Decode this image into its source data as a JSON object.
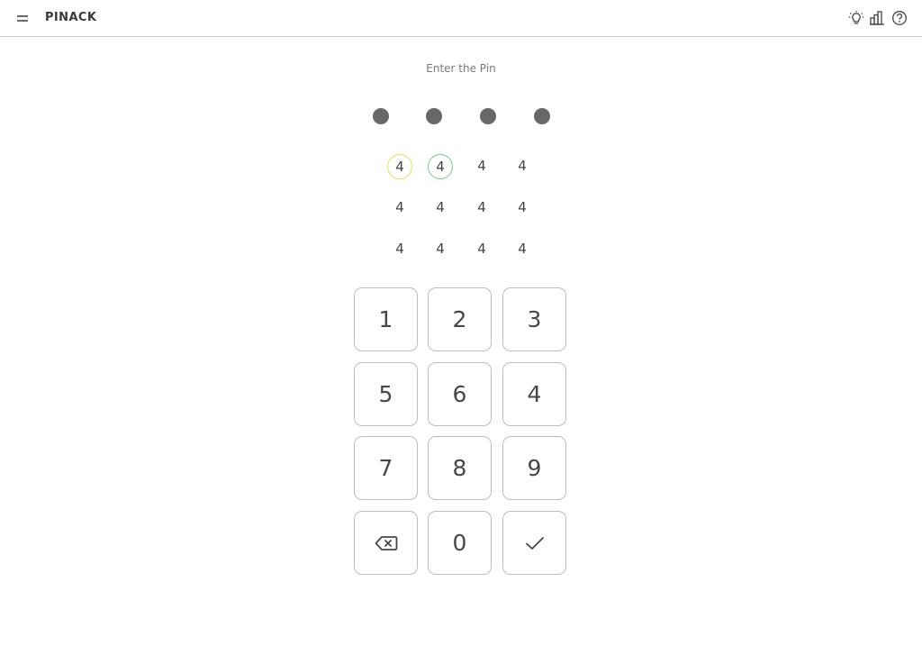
{
  "header": {
    "title": "PINACK",
    "icons": [
      "menu-icon",
      "lightbulb-icon",
      "bar-chart-icon",
      "help-icon"
    ]
  },
  "prompt": "Enter the Pin",
  "pin_dots": 4,
  "digit_grid": [
    [
      "4",
      "4",
      "4",
      "4"
    ],
    [
      "4",
      "4",
      "4",
      "4"
    ],
    [
      "4",
      "4",
      "4",
      "4"
    ]
  ],
  "keypad": {
    "rows": [
      [
        "1",
        "2",
        "3"
      ],
      [
        "5",
        "6",
        "4"
      ],
      [
        "7",
        "8",
        "9"
      ],
      [
        "",
        "0",
        ""
      ]
    ],
    "backspace_icon": "backspace-icon",
    "confirm_icon": "checkmark-icon"
  },
  "colors": {
    "accent_yellow": "#ecdc4a",
    "accent_green": "#6fcb8a",
    "dot": "#686868",
    "border": "#bdbdbd"
  }
}
